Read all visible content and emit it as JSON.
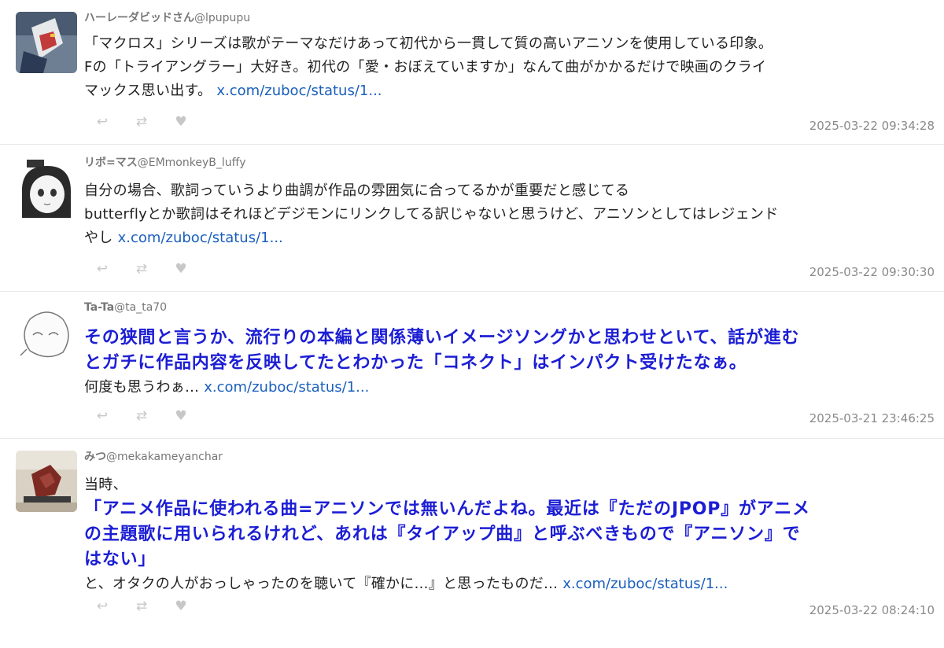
{
  "tweets": [
    {
      "name": "ハーレーダビッドさん",
      "handle": "@lpupupu",
      "lines": [
        "「マクロス」シリーズは歌がテーマなだけあって初代から一貫して質の高いアニソンを使用している印象。",
        "Fの「トライアングラー」大好き。初代の「愛・おぼえていますか」なんて曲がかかるだけで映画のクライ",
        "マックス思い出す。"
      ],
      "link": "x.com/zuboc/status/1...",
      "time": "2025-03-22 09:34:28"
    },
    {
      "name": "リボ=マス",
      "handle": "@EMmonkeyB_luffy",
      "lines": [
        "自分の場合、歌詞っていうより曲調が作品の雰囲気に合ってるかが重要だと感じてる",
        "butterflyとか歌詞はそれほどデジモンにリンクしてる訳じゃないと思うけど、アニソンとしてはレジェンド",
        "やし"
      ],
      "link": "x.com/zuboc/status/1...",
      "time": "2025-03-22 09:30:30"
    },
    {
      "name": "Ta-Ta",
      "handle": "@ta_ta70",
      "emphasis": [
        "その狭間と言うか、流行りの本編と関係薄いイメージソングかと思わせといて、話が進む",
        "とガチに作品内容を反映してたとわかった「コネクト」はインパクト受けたなぁ。"
      ],
      "lines": [
        "何度も思うわぁ..."
      ],
      "link": "x.com/zuboc/status/1...",
      "time": "2025-03-21 23:46:25"
    },
    {
      "name": "みつ",
      "handle": "@mekakameyanchar",
      "pre": "当時、",
      "emphasis": [
        "「アニメ作品に使われる曲=アニソンでは無いんだよね。最近は『ただのJPOP』がアニメ",
        "の主題歌に用いられるけれど、あれは『タイアップ曲』と呼ぶべきもので『アニソン』で",
        "はない」"
      ],
      "lines": [
        "と、オタクの人がおっしゃったのを聴いて『確かに...』と思ったものだ..."
      ],
      "link": "x.com/zuboc/status/1...",
      "time": "2025-03-22 08:24:10"
    }
  ],
  "icons": {
    "reply": "↩",
    "retweet": "⇄",
    "like": "♥"
  },
  "colors": {
    "link": "#1a5fbd",
    "emphasis": "#1c1ed4",
    "meta": "#8a8a8a",
    "action": "#c7c7c7"
  }
}
